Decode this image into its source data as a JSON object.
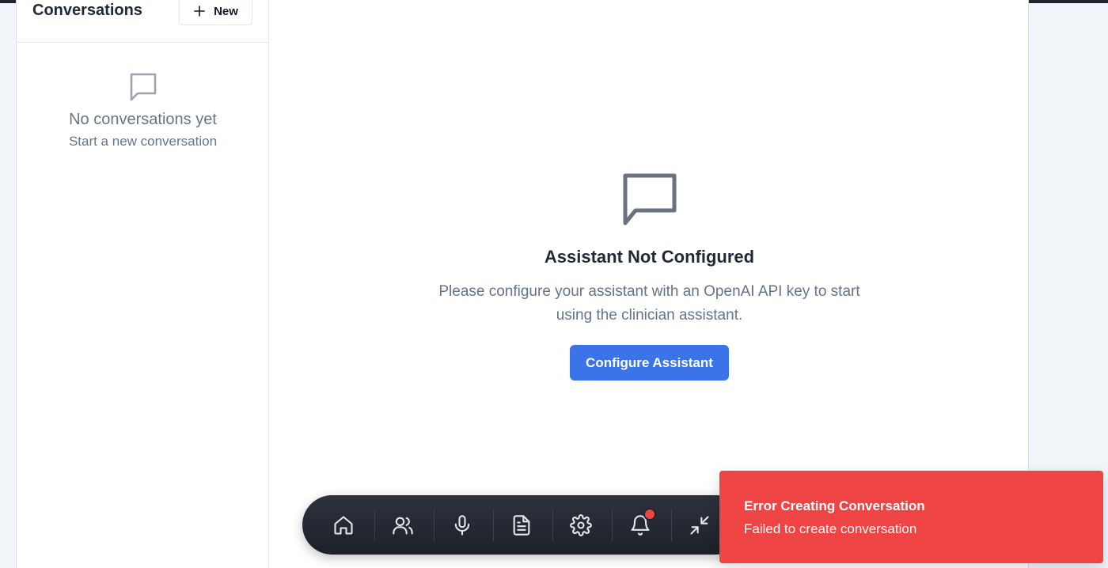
{
  "sidebar": {
    "title": "Conversations",
    "new_button_label": "New",
    "empty_title": "No conversations yet",
    "empty_subtitle": "Start a new conversation"
  },
  "main": {
    "heading": "Assistant Not Configured",
    "message": "Please configure your assistant with an OpenAI API key to start using the clinician assistant.",
    "configure_button_label": "Configure Assistant"
  },
  "dock": {
    "items": [
      {
        "icon": "home-icon"
      },
      {
        "icon": "users-icon"
      },
      {
        "icon": "microphone-icon"
      },
      {
        "icon": "document-icon"
      },
      {
        "icon": "settings-icon"
      },
      {
        "icon": "bell-icon",
        "has_notification": true
      },
      {
        "icon": "minimize-icon"
      }
    ]
  },
  "toast": {
    "title": "Error Creating Conversation",
    "description": "Failed to create conversation",
    "color": "#ef4444"
  },
  "colors": {
    "accent": "#3b74e8",
    "muted_text": "#64748b",
    "dock_background": "#1f2430"
  }
}
